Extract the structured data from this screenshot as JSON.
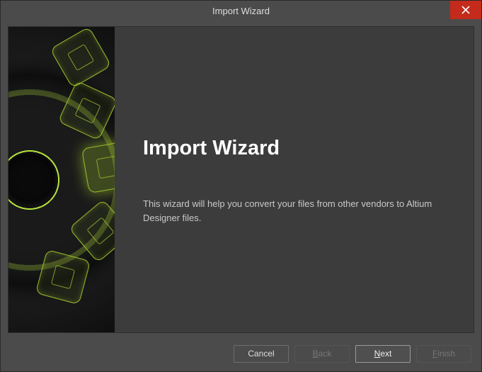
{
  "window": {
    "title": "Import Wizard"
  },
  "main": {
    "heading": "Import Wizard",
    "body": "This wizard will help you convert your files from other vendors to Altium Designer files."
  },
  "buttons": {
    "cancel": "Cancel",
    "back_prefix": "B",
    "back_rest": "ack",
    "next_prefix": "N",
    "next_rest": "ext",
    "finish_prefix": "F",
    "finish_rest": "inish"
  },
  "colors": {
    "accent": "#9bbf2e",
    "close": "#c42b1c",
    "background": "#4b4b4b",
    "panel": "#3c3c3c"
  }
}
